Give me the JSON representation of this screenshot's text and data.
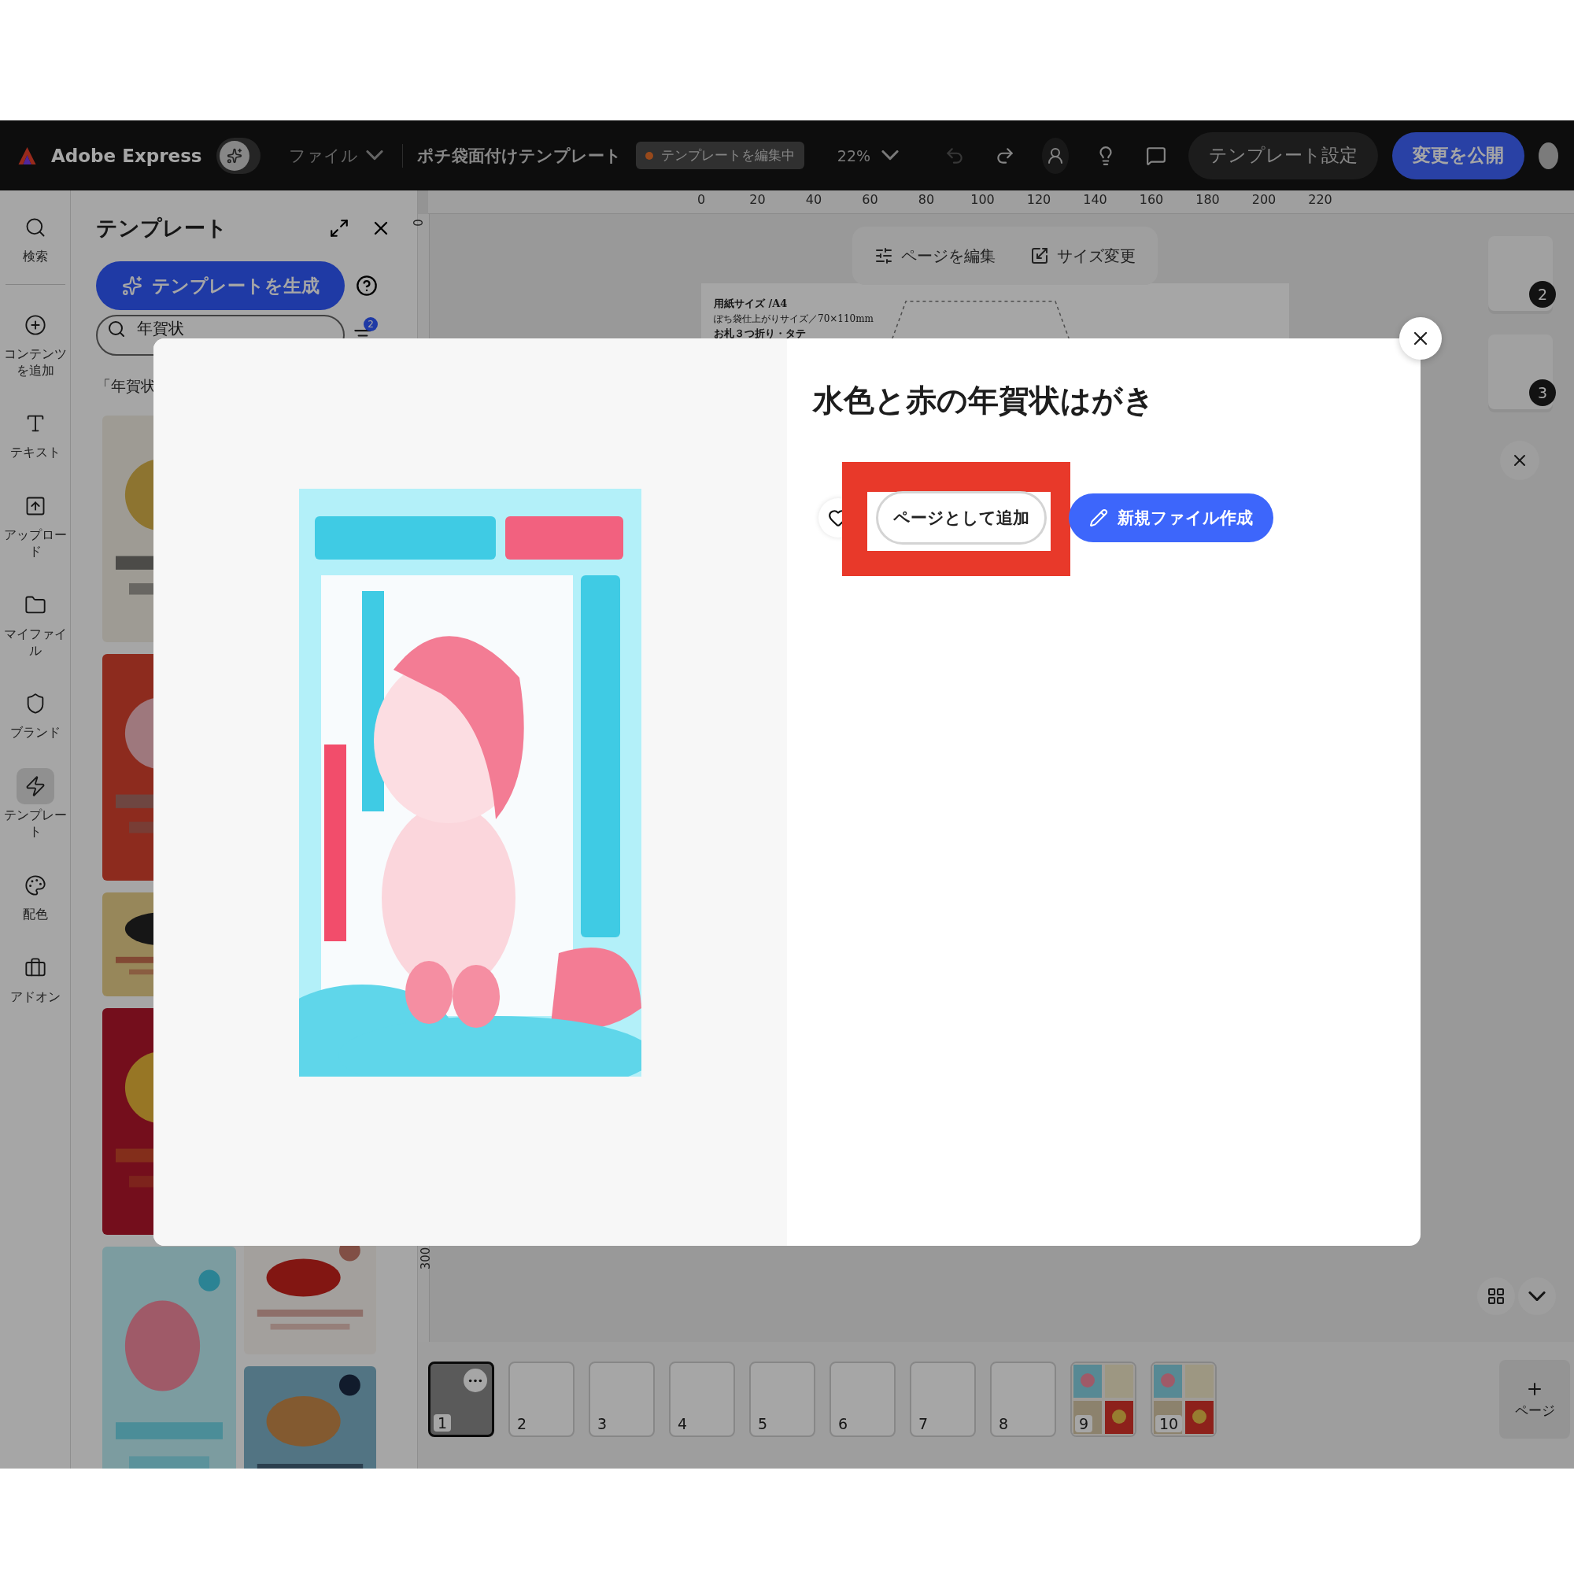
{
  "top_bar": {
    "app_name": "Adobe Express",
    "file_menu": "ファイル",
    "document_title": "ポチ袋面付けテンプレート",
    "status_badge": "テンプレートを編集中",
    "zoom": "22%",
    "settings_button": "テンプレート設定",
    "publish_button": "変更を公開",
    "assistant_toggle": {
      "on": false
    }
  },
  "rail": [
    {
      "kind": "search",
      "label": "検索",
      "selected": false
    },
    {
      "kind": "add",
      "label": "コンテンツを追加",
      "selected": false
    },
    {
      "kind": "text",
      "label": "テキスト",
      "selected": false
    },
    {
      "kind": "upload",
      "label": "アップロード",
      "selected": false
    },
    {
      "kind": "folder",
      "label": "マイファイル",
      "selected": false
    },
    {
      "kind": "brand",
      "label": "ブランド",
      "selected": false
    },
    {
      "kind": "template",
      "label": "テンプレート",
      "selected": true
    },
    {
      "kind": "color",
      "label": "配色",
      "selected": false
    },
    {
      "kind": "addon",
      "label": "アドオン",
      "selected": false
    }
  ],
  "panel": {
    "title": "テンプレート",
    "generate_button": "テンプレートを生成",
    "search": {
      "value": "年賀状"
    },
    "filter_count": "2",
    "results_label": "「年賀状"
  },
  "canvas": {
    "ruler_ticks": [
      "0",
      "20",
      "40",
      "60",
      "80",
      "100",
      "120",
      "140",
      "160",
      "180",
      "200",
      "220"
    ],
    "vertical_ruler": [
      "0",
      "300"
    ],
    "toolbar": [
      "ページを編集",
      "サイズ変更"
    ],
    "page_lines": [
      "用紙サイズ /A4",
      "ぽち袋仕上がりサイズ／70×110mm",
      "お札３つ折り・タテ"
    ],
    "side_pages": [
      "2",
      "3"
    ],
    "page_strip": [
      {
        "number": "1",
        "selected": true,
        "kind": "blank"
      },
      {
        "number": "2",
        "selected": false,
        "kind": "blank"
      },
      {
        "number": "3",
        "selected": false,
        "kind": "blank"
      },
      {
        "number": "4",
        "selected": false,
        "kind": "blank"
      },
      {
        "number": "5",
        "selected": false,
        "kind": "blank"
      },
      {
        "number": "6",
        "selected": false,
        "kind": "blank"
      },
      {
        "number": "7",
        "selected": false,
        "kind": "blank"
      },
      {
        "number": "8",
        "selected": false,
        "kind": "blank"
      },
      {
        "number": "9",
        "selected": false,
        "kind": "collage"
      },
      {
        "number": "10",
        "selected": false,
        "kind": "collage"
      }
    ],
    "add_page_button": "ページ"
  },
  "modal": {
    "title": "水色と赤の年賀状はがき",
    "favorited": false,
    "add_as_page_button": "ページとして追加",
    "new_file_button": "新規ファイル作成"
  }
}
